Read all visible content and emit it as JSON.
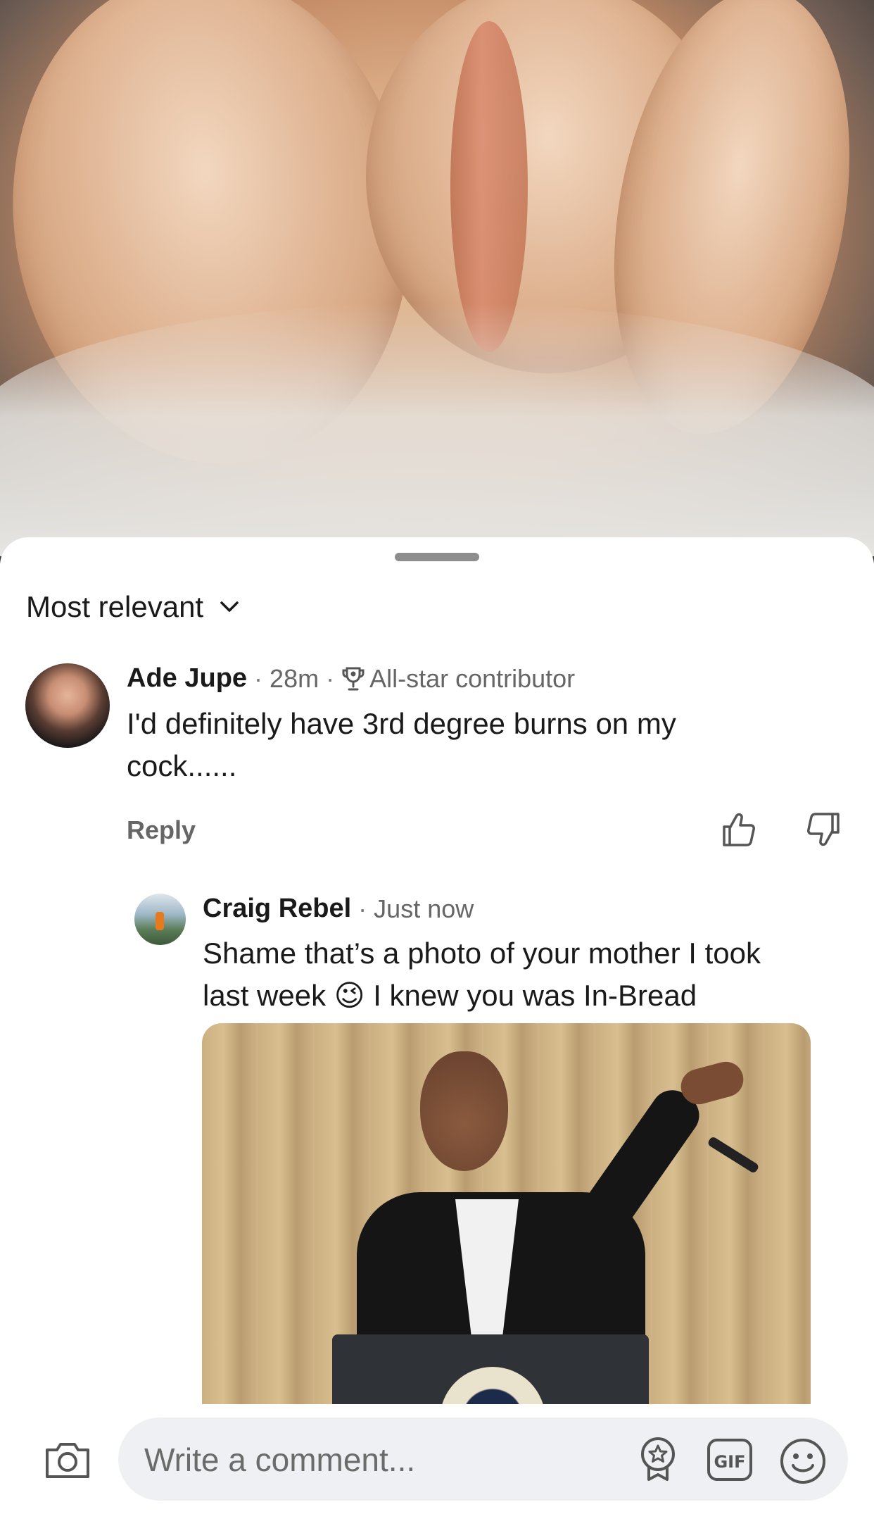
{
  "post": {
    "image_icon": "bread-photo"
  },
  "comments": {
    "sort_label": "Most relevant",
    "items": [
      {
        "author": "Ade Jupe",
        "time": "28m",
        "badge": "All-star contributor",
        "text_line1": "I'd definitely have 3rd degree burns on my",
        "text_line2": "cock......",
        "reply_label": "Reply"
      }
    ],
    "replies": [
      {
        "author": "Craig Rebel",
        "time": "Just now",
        "text_line1": "Shame that’s a photo of your mother I took",
        "text_line2_a": "last week",
        "emoji": "😉",
        "text_line2_b": "I knew you was In-Bread"
      }
    ]
  },
  "composer": {
    "placeholder": "Write a comment...",
    "icons": [
      "camera-icon",
      "sticker-icon",
      "gif-icon",
      "emoji-icon"
    ],
    "gif_label": "GIF"
  },
  "colors": {
    "text_primary": "#1a1a1a",
    "text_secondary": "#666666",
    "input_bg": "#eef0f4"
  }
}
